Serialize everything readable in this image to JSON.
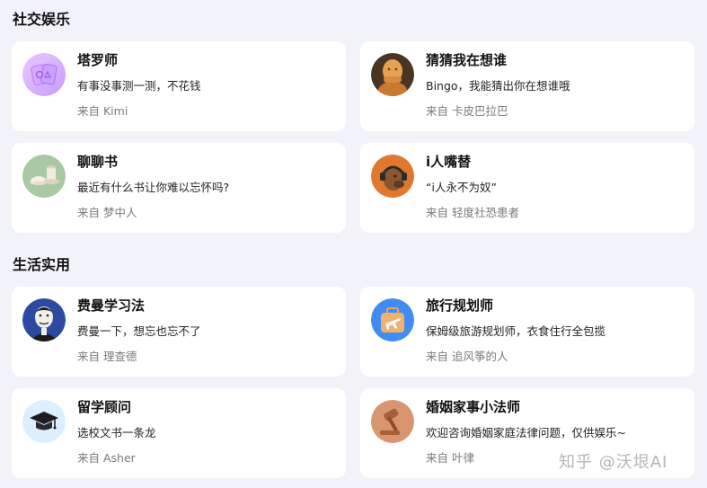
{
  "sections": [
    {
      "title": "社交娱乐",
      "cards": [
        {
          "name": "塔罗师",
          "desc": "有事没事测一测，不花钱",
          "author": "来自 Kimi",
          "icon": "tarot-cards-icon"
        },
        {
          "name": "猜猜我在想谁",
          "desc": "Bingo，我能猜出你在想谁哦",
          "author": "来自 卡皮巴拉巴",
          "icon": "thinking-figure-icon"
        },
        {
          "name": "聊聊书",
          "desc": "最近有什么书让你难以忘怀吗?",
          "author": "来自 梦中人",
          "icon": "book-cup-icon"
        },
        {
          "name": "i人嘴替",
          "desc": "“i人永不为奴”",
          "author": "来自 轻度社恐患者",
          "icon": "dog-headphones-icon"
        }
      ]
    },
    {
      "title": "生活实用",
      "cards": [
        {
          "name": "费曼学习法",
          "desc": "费曼一下，想忘也忘不了",
          "author": "来自 理查德",
          "icon": "feynman-portrait-icon"
        },
        {
          "name": "旅行规划师",
          "desc": "保姆级旅游规划师，衣食住行全包揽",
          "author": "来自 追风筝的人",
          "icon": "suitcase-plane-icon"
        },
        {
          "name": "留学顾问",
          "desc": "选校文书一条龙",
          "author": "来自 Asher",
          "icon": "graduation-cap-icon"
        },
        {
          "name": "婚姻家事小法师",
          "desc": "欢迎咨询婚姻家庭法律问题，仅供娱乐~",
          "author": "来自 叶律",
          "icon": "gavel-icon"
        }
      ]
    }
  ],
  "watermark": "知乎 @沃垠AI"
}
